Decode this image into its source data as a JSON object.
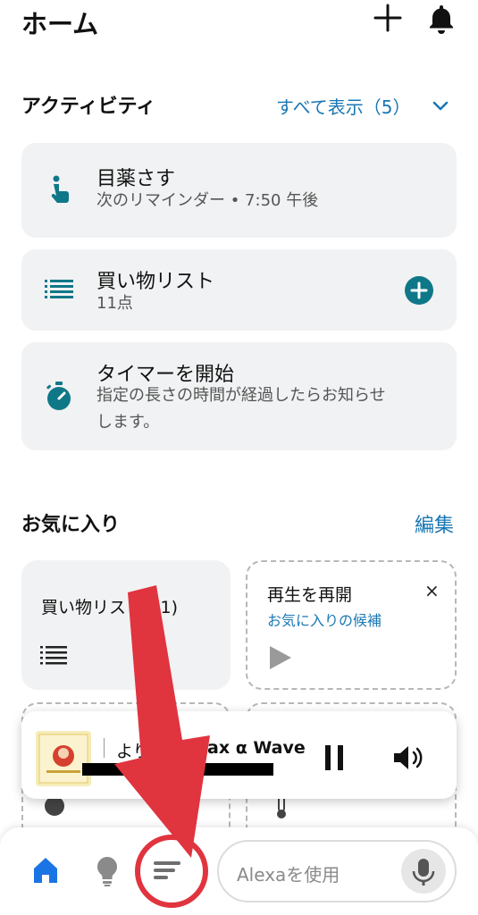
{
  "header": {
    "title": "ホーム",
    "add_icon": "plus-icon",
    "notification_icon": "bell-icon"
  },
  "activity": {
    "heading": "アクティビティ",
    "show_all": "すべて表示（5）",
    "items": [
      {
        "title": "目薬さす",
        "subtitle": "次のリマインダー • 7:50 午後",
        "icon": "hand-tap-icon"
      },
      {
        "title": "買い物リスト",
        "subtitle": "11点",
        "icon": "list-icon"
      },
      {
        "title": "タイマーを開始",
        "subtitle_line1": "指定の長さの時間が経過したらお知らせ",
        "subtitle_line2": "します。",
        "icon": "stopwatch-icon"
      }
    ]
  },
  "favorites": {
    "heading": "お気に入り",
    "edit": "編集",
    "shopping": {
      "label": "買い物リスト(11)"
    },
    "resume": {
      "title": "再生を再開",
      "subtitle": "お気に入りの候補",
      "close": "×"
    }
  },
  "now_playing": {
    "prefix": "より",
    "track": "Relax α Wave"
  },
  "bottom_nav": {
    "alexa_placeholder": "Alexaを使用"
  },
  "colors": {
    "accent": "#1a77b4",
    "teal": "#0f7888",
    "annotation_red": "#e0343f",
    "home_blue": "#1b74e4"
  }
}
